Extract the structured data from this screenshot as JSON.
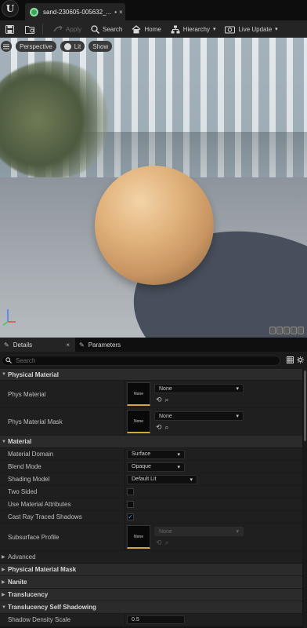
{
  "tab": {
    "title": "sand-230605-005632_...",
    "dirty": "•",
    "close": "×"
  },
  "toolbar": {
    "apply": "Apply",
    "search": "Search",
    "home": "Home",
    "hierarchy": "Hierarchy",
    "live_update": "Live Update"
  },
  "viewport": {
    "perspective": "Perspective",
    "lit": "Lit",
    "show": "Show"
  },
  "panel_tabs": {
    "details": "Details",
    "parameters": "Parameters"
  },
  "search": {
    "placeholder": "Search"
  },
  "sections": {
    "physical_material": "Physical Material",
    "material": "Material",
    "advanced": "Advanced",
    "physical_material_mask": "Physical Material Mask",
    "nanite": "Nanite",
    "translucency": "Translucency",
    "translucency_self_shadowing": "Translucency Self Shadowing"
  },
  "props": {
    "phys_material": {
      "label": "Phys Material",
      "thumb": "None",
      "value": "None"
    },
    "phys_material_mask": {
      "label": "Phys Material Mask",
      "thumb": "None",
      "value": "None"
    },
    "material_domain": {
      "label": "Material Domain",
      "value": "Surface"
    },
    "blend_mode": {
      "label": "Blend Mode",
      "value": "Opaque"
    },
    "shading_model": {
      "label": "Shading Model",
      "value": "Default Lit"
    },
    "two_sided": {
      "label": "Two Sided",
      "checked": false
    },
    "use_material_attributes": {
      "label": "Use Material Attributes",
      "checked": false
    },
    "cast_ray_traced_shadows": {
      "label": "Cast Ray Traced Shadows",
      "checked": true
    },
    "subsurface_profile": {
      "label": "Subsurface Profile",
      "thumb": "None",
      "value": "None"
    },
    "shadow_density_scale": {
      "label": "Shadow Density Scale",
      "value": "0.5"
    }
  },
  "colors": {
    "accent_gold": "#d5a341",
    "check_blue": "#4d9cf5",
    "material_icon": "#3ca55c",
    "panel_bg": "#1f1f1f"
  },
  "icons": {
    "logo": "unreal-logo-icon",
    "save": "save-icon",
    "browse": "content-browser-icon",
    "apply": "apply-icon",
    "search": "search-icon",
    "home": "home-icon",
    "hierarchy": "hierarchy-icon",
    "live_update": "live-update-icon"
  }
}
